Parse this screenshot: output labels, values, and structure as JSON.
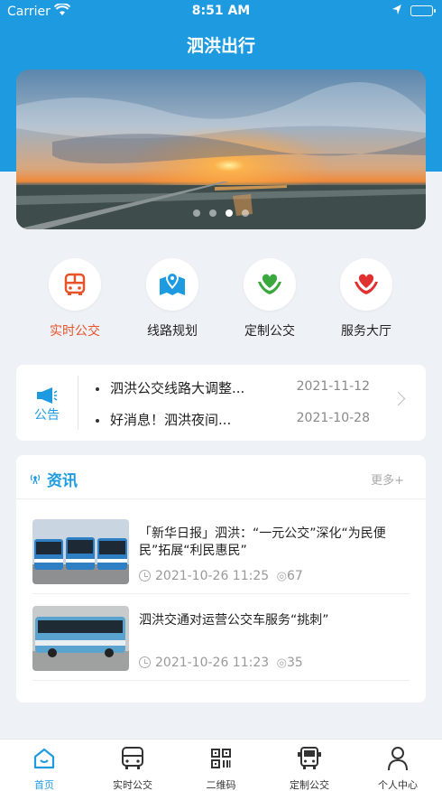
{
  "status": {
    "carrier": "Carrier",
    "time": "8:51 AM"
  },
  "app": {
    "title": "泗洪出行"
  },
  "banner": {
    "slide_count": 4,
    "active_index": 2
  },
  "quick": [
    {
      "label": "实时公交",
      "icon": "bus-icon",
      "color": "#e8532a"
    },
    {
      "label": "线路规划",
      "icon": "map-pin-icon",
      "color": "#1e9be0"
    },
    {
      "label": "定制公交",
      "icon": "heart-hand-icon",
      "color": "#3aa83c"
    },
    {
      "label": "服务大厅",
      "icon": "heart-hand-icon",
      "color": "#e03030"
    }
  ],
  "notice": {
    "label": "公告",
    "items": [
      {
        "title": "泗洪公交线路大调整...",
        "date": "2021-11-12"
      },
      {
        "title": "好消息！泗洪夜间...",
        "date": "2021-10-28"
      }
    ]
  },
  "news": {
    "title": "资讯",
    "more": "更多+",
    "items": [
      {
        "title": "「新华日报」泗洪：“一元公交”深化“为民便民”拓展“利民惠民”",
        "time": "2021-10-26 11:25",
        "views": "67"
      },
      {
        "title": "泗洪交通对运营公交车服务“挑刺”",
        "time": "2021-10-26 11:23",
        "views": "35"
      }
    ]
  },
  "tabs": [
    {
      "label": "首页",
      "active": true
    },
    {
      "label": "实时公交"
    },
    {
      "label": "二维码"
    },
    {
      "label": "定制公交"
    },
    {
      "label": "个人中心"
    }
  ],
  "colors": {
    "primary": "#1e9be0",
    "accent": "#e8532a",
    "background": "#eef2f7"
  }
}
